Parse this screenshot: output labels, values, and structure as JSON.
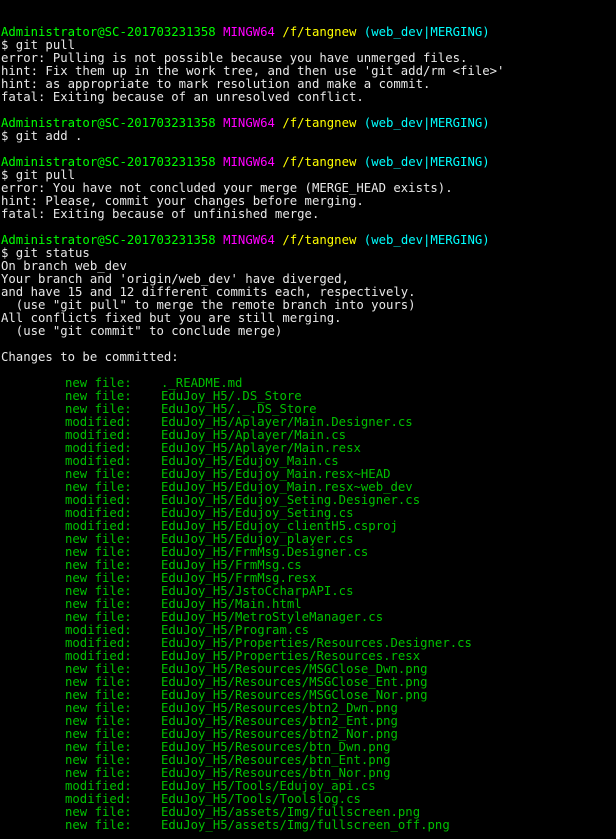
{
  "colors": {
    "prompt_user": "#00ff00",
    "mingw": "#ff00ff",
    "path": "#ffff00",
    "branch": "#00ffff",
    "text": "#e8e8e8",
    "staged": "#00c000",
    "background": "#000000"
  },
  "prompt": {
    "user_host": "Administrator@SC-201703231358",
    "mingw": "MINGW64",
    "path": "/f/tangnew",
    "branch": "(web_dev|MERGING)"
  },
  "blocks": [
    {
      "command": "$ git pull",
      "output": [
        "error: Pulling is not possible because you have unmerged files.",
        "hint: Fix them up in the work tree, and then use 'git add/rm <file>'",
        "hint: as appropriate to mark resolution and make a commit.",
        "fatal: Exiting because of an unresolved conflict."
      ]
    },
    {
      "command": "$ git add .",
      "output": []
    },
    {
      "command": "$ git pull",
      "output": [
        "error: You have not concluded your merge (MERGE_HEAD exists).",
        "hint: Please, commit your changes before merging.",
        "fatal: Exiting because of unfinished merge."
      ]
    },
    {
      "command": "$ git status",
      "output": [
        "On branch web_dev",
        "Your branch and 'origin/web_dev' have diverged,",
        "and have 15 and 12 different commits each, respectively.",
        "  (use \"git pull\" to merge the remote branch into yours)",
        "All conflicts fixed but you are still merging.",
        "  (use \"git commit\" to conclude merge)",
        "",
        "Changes to be committed:",
        ""
      ]
    }
  ],
  "files": [
    {
      "status": "new file:",
      "path": "._README.md"
    },
    {
      "status": "new file:",
      "path": "EduJoy_H5/.DS_Store"
    },
    {
      "status": "new file:",
      "path": "EduJoy_H5/._.DS_Store"
    },
    {
      "status": "modified:",
      "path": "EduJoy_H5/Aplayer/Main.Designer.cs"
    },
    {
      "status": "modified:",
      "path": "EduJoy_H5/Aplayer/Main.cs"
    },
    {
      "status": "modified:",
      "path": "EduJoy_H5/Aplayer/Main.resx"
    },
    {
      "status": "modified:",
      "path": "EduJoy_H5/Edujoy_Main.cs"
    },
    {
      "status": "new file:",
      "path": "EduJoy_H5/Edujoy_Main.resx~HEAD"
    },
    {
      "status": "new file:",
      "path": "EduJoy_H5/Edujoy_Main.resx~web_dev"
    },
    {
      "status": "modified:",
      "path": "EduJoy_H5/Edujoy_Seting.Designer.cs"
    },
    {
      "status": "modified:",
      "path": "EduJoy_H5/Edujoy_Seting.cs"
    },
    {
      "status": "modified:",
      "path": "EduJoy_H5/Edujoy_clientH5.csproj"
    },
    {
      "status": "new file:",
      "path": "EduJoy_H5/Edujoy_player.cs"
    },
    {
      "status": "new file:",
      "path": "EduJoy_H5/FrmMsg.Designer.cs"
    },
    {
      "status": "new file:",
      "path": "EduJoy_H5/FrmMsg.cs"
    },
    {
      "status": "new file:",
      "path": "EduJoy_H5/FrmMsg.resx"
    },
    {
      "status": "new file:",
      "path": "EduJoy_H5/JstoCcharpAPI.cs"
    },
    {
      "status": "new file:",
      "path": "EduJoy_H5/Main.html"
    },
    {
      "status": "new file:",
      "path": "EduJoy_H5/MetroStyleManager.cs"
    },
    {
      "status": "modified:",
      "path": "EduJoy_H5/Program.cs"
    },
    {
      "status": "modified:",
      "path": "EduJoy_H5/Properties/Resources.Designer.cs"
    },
    {
      "status": "modified:",
      "path": "EduJoy_H5/Properties/Resources.resx"
    },
    {
      "status": "new file:",
      "path": "EduJoy_H5/Resources/MSGClose_Dwn.png"
    },
    {
      "status": "new file:",
      "path": "EduJoy_H5/Resources/MSGClose_Ent.png"
    },
    {
      "status": "new file:",
      "path": "EduJoy_H5/Resources/MSGClose_Nor.png"
    },
    {
      "status": "new file:",
      "path": "EduJoy_H5/Resources/btn2_Dwn.png"
    },
    {
      "status": "new file:",
      "path": "EduJoy_H5/Resources/btn2_Ent.png"
    },
    {
      "status": "new file:",
      "path": "EduJoy_H5/Resources/btn2_Nor.png"
    },
    {
      "status": "new file:",
      "path": "EduJoy_H5/Resources/btn_Dwn.png"
    },
    {
      "status": "new file:",
      "path": "EduJoy_H5/Resources/btn_Ent.png"
    },
    {
      "status": "new file:",
      "path": "EduJoy_H5/Resources/btn_Nor.png"
    },
    {
      "status": "modified:",
      "path": "EduJoy_H5/Tools/Edujoy_api.cs"
    },
    {
      "status": "modified:",
      "path": "EduJoy_H5/Tools/Toolslog.cs"
    },
    {
      "status": "new file:",
      "path": "EduJoy_H5/assets/Img/fullscreen.png"
    },
    {
      "status": "new file:",
      "path": "EduJoy_H5/assets/Img/fullscreen_off.png"
    }
  ]
}
